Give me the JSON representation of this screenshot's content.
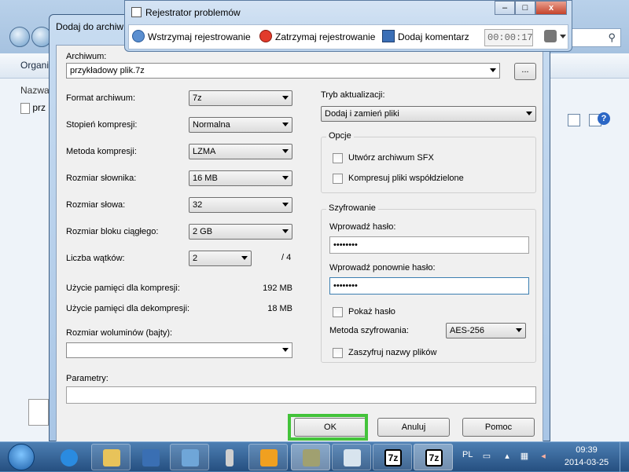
{
  "explorer": {
    "toolbar_label": "Organi",
    "column_header": "Nazwa",
    "file_label": "prz"
  },
  "psr": {
    "title": "Rejestrator problemów",
    "pause": "Wstrzymaj rejestrowanie",
    "stop": "Zatrzymaj rejestrowanie",
    "comment": "Dodaj komentarz",
    "timer": "00:00:17",
    "controls": {
      "minimize": "–",
      "maximize": "□",
      "close": "x"
    }
  },
  "dialog": {
    "title": "Dodaj do archiw",
    "archive_label": "Archiwum:",
    "archive_value": "przykładowy plik.7z",
    "browse": "...",
    "format_label": "Format archiwum:",
    "format_value": "7z",
    "level_label": "Stopień kompresji:",
    "level_value": "Normalna",
    "method_label": "Metoda kompresji:",
    "method_value": "LZMA",
    "dict_label": "Rozmiar słownika:",
    "dict_value": "16 MB",
    "word_label": "Rozmiar słowa:",
    "word_value": "32",
    "solid_label": "Rozmiar bloku ciągłego:",
    "solid_value": "2 GB",
    "threads_label": "Liczba wątków:",
    "threads_value": "2",
    "threads_max": "/ 4",
    "mem_comp_label": "Użycie pamięci dla kompresji:",
    "mem_comp_value": "192 MB",
    "mem_decomp_label": "Użycie pamięci dla dekompresji:",
    "mem_decomp_value": "18 MB",
    "volume_label": "Rozmiar woluminów (bajty):",
    "volume_value": "",
    "params_label": "Parametry:",
    "params_value": "",
    "update_label": "Tryb aktualizacji:",
    "update_value": "Dodaj i zamień pliki",
    "options_group": "Opcje",
    "sfx_label": "Utwórz archiwum SFX",
    "shared_label": "Kompresuj pliki współdzielone",
    "encryption_group": "Szyfrowanie",
    "password_label": "Wprowadź hasło:",
    "password_value": "••••••••",
    "password2_label": "Wprowadź ponownie hasło:",
    "password2_value": "••••••••",
    "show_password_label": "Pokaż hasło",
    "enc_method_label": "Metoda szyfrowania:",
    "enc_method_value": "AES-256",
    "encrypt_names_label": "Zaszyfruj nazwy plików",
    "ok": "OK",
    "cancel": "Anuluj",
    "help": "Pomoc"
  },
  "taskbar": {
    "lang": "PL",
    "time": "09:39",
    "date": "2014-03-25",
    "app_7z_label": "7z",
    "app_7z_label2": "7z"
  }
}
